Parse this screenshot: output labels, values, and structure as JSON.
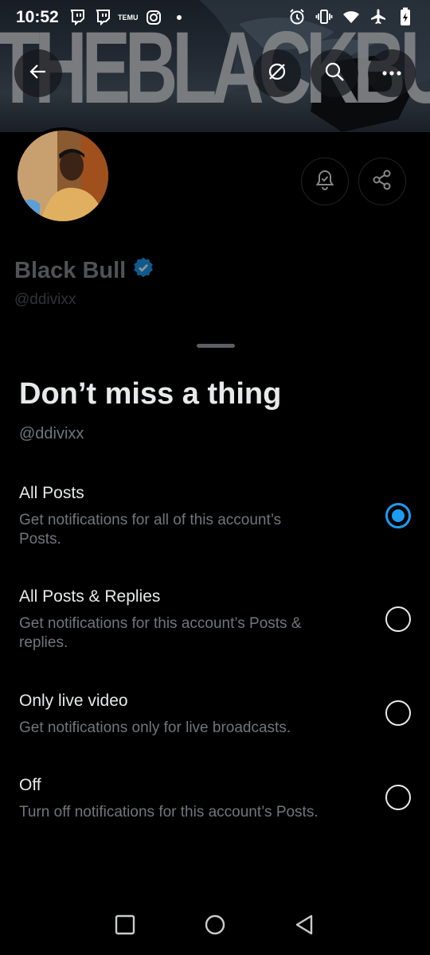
{
  "status_bar": {
    "time": "10:52",
    "left_icons": [
      "twitch-icon",
      "twitch-icon",
      "temu-icon",
      "instagram-icon",
      "dot-icon"
    ],
    "temu_label": "TEMU",
    "right_icons": [
      "alarm-icon",
      "vibrate-icon",
      "wifi-icon",
      "airplane-icon",
      "battery-icon"
    ]
  },
  "banner": {
    "text": "THEBLACKBULL"
  },
  "header_actions": {
    "back": "back-arrow-icon",
    "grok": "grok-icon",
    "search": "search-icon",
    "more": "more-icon"
  },
  "profile": {
    "name": "Black Bull",
    "handle": "@ddivixx",
    "verified_icon": "verified-badge-icon",
    "verified_color": "#1d9bf0",
    "notify_button_icon": "bell-check-icon",
    "share_button_icon": "share-icon"
  },
  "sheet": {
    "title": "Don’t miss a thing",
    "subtitle": "@ddivixx",
    "options": [
      {
        "title": "All Posts",
        "desc_line1": "Get notifications for all of this account’s",
        "desc_line2": "Posts.",
        "selected": true
      },
      {
        "title": "All Posts & Replies",
        "desc_line1": "Get notifications for this account’s Posts &",
        "desc_line2": "replies.",
        "selected": false
      },
      {
        "title": "Only live video",
        "desc_line1": "Get notifications only for live broadcasts.",
        "desc_line2": "",
        "selected": false
      },
      {
        "title": "Off",
        "desc_line1": "Turn off notifications for this account’s Posts.",
        "desc_line2": "",
        "selected": false
      }
    ]
  },
  "nav_bar": {
    "recents": "recents-square-icon",
    "home": "home-circle-icon",
    "back": "back-triangle-icon"
  },
  "colors": {
    "accent": "#1d9bf0",
    "background": "#000000",
    "text_primary": "#e7e9ea",
    "text_secondary": "#71767b"
  }
}
